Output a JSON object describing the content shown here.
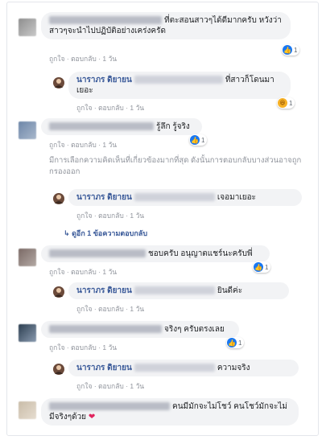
{
  "comments": [
    {
      "text": "ที่ตะสอนสาวๆได้ดีมากครับ หวังว่าสาวๆจะนำไปปฏิบัติอย่างเคร่งครัด",
      "time": "1 วัน",
      "like_count": "1",
      "reply": {
        "author": "นาราภร ดิยายน",
        "text": "ที่สาวก็โดนมาเยอะ",
        "time": "1 วัน",
        "haha_count": "1"
      }
    },
    {
      "text": "รู้ลึก รู้จริง",
      "time": "1 วัน",
      "like_count": "1",
      "notice": "มีการเลือกความคิดเห็นที่เกี่ยวข้องมากที่สุด ดังนั้นการตอบกลับบางส่วนอาจถูกกรองออก",
      "reply": {
        "author": "นาราภร ดิยายน",
        "text": "เจอมาเยอะ",
        "time": "1 วัน"
      },
      "more_replies": "ดูอีก 1 ข้อความตอบกลับ"
    },
    {
      "text": "ชอบครับ อนุญาตแชร์นะครับพี่",
      "time": "1 วัน",
      "like_count": "1",
      "reply": {
        "author": "นาราภร ดิยายน",
        "text": "ยินดีค่ะ",
        "time": "1 วัน"
      }
    },
    {
      "text": "จริงๆ ครับตรงเลย",
      "time": "1 วัน",
      "like_count": "1",
      "reply": {
        "author": "นาราภร ดิยายน",
        "text": "ความจริง",
        "time": "1 วัน"
      }
    },
    {
      "text": "คนมีมักจะไม่โชว์ คนโชว์มักจะไม่มีจริงๆด้วย",
      "emoji": "❤"
    }
  ],
  "labels": {
    "like": "ถูกใจ",
    "reply": "ตอบกลับ",
    "sep": "·"
  }
}
